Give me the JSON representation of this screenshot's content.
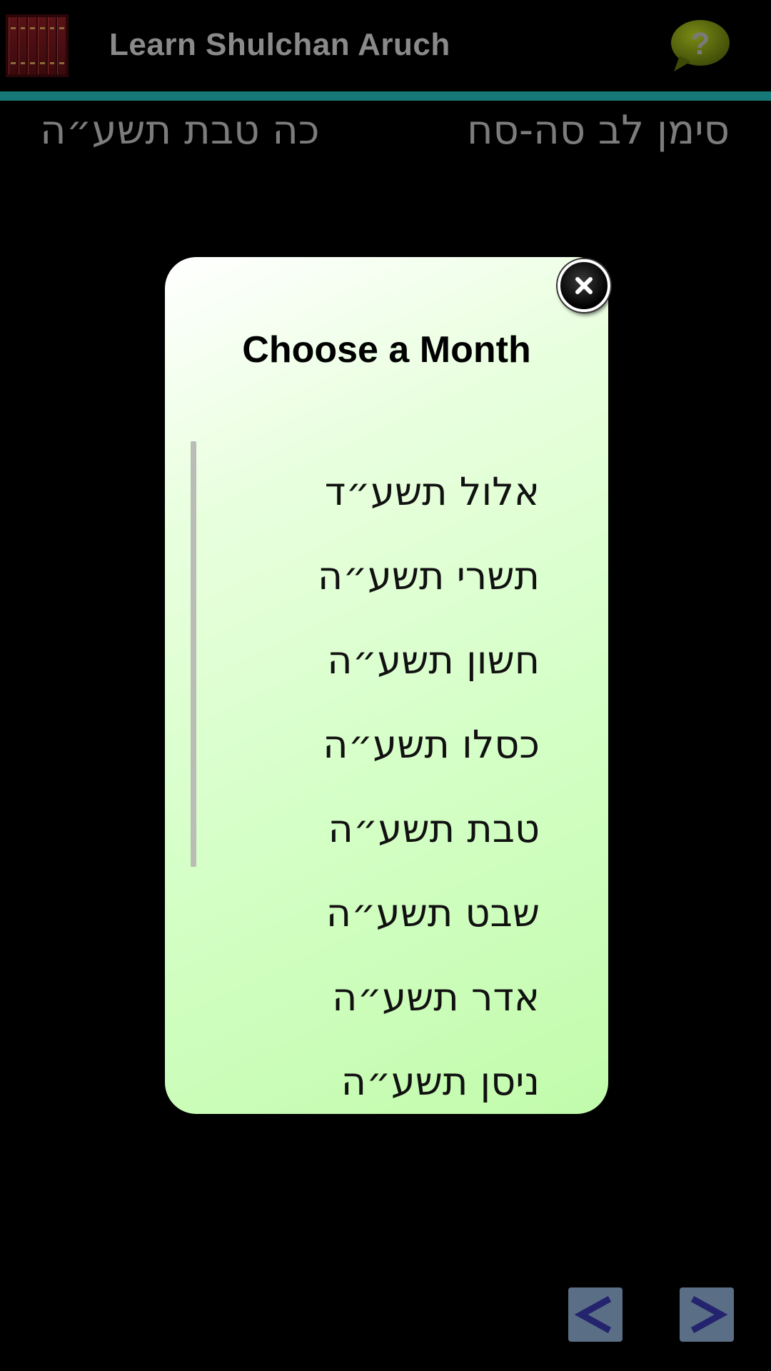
{
  "appbar": {
    "title": "Learn Shulchan Aruch",
    "accent_color": "#177878",
    "icon": "books-icon",
    "help_icon": "help-bubble-icon"
  },
  "header": {
    "simanim": "סימן לב סה-סח",
    "date": "כה טבת תשע״ה"
  },
  "dialog": {
    "title": "Choose a Month",
    "close_icon": "close-icon",
    "months": [
      "אלול תשע״ד",
      "תשרי תשע״ה",
      "חשון תשע״ה",
      "כסלו תשע״ה",
      "טבת תשע״ה",
      "שבט תשע״ה",
      "אדר תשע״ה",
      "ניסן תשע״ה"
    ]
  },
  "nav": {
    "prev_icon": "chevron-left-icon",
    "next_icon": "chevron-right-icon"
  }
}
